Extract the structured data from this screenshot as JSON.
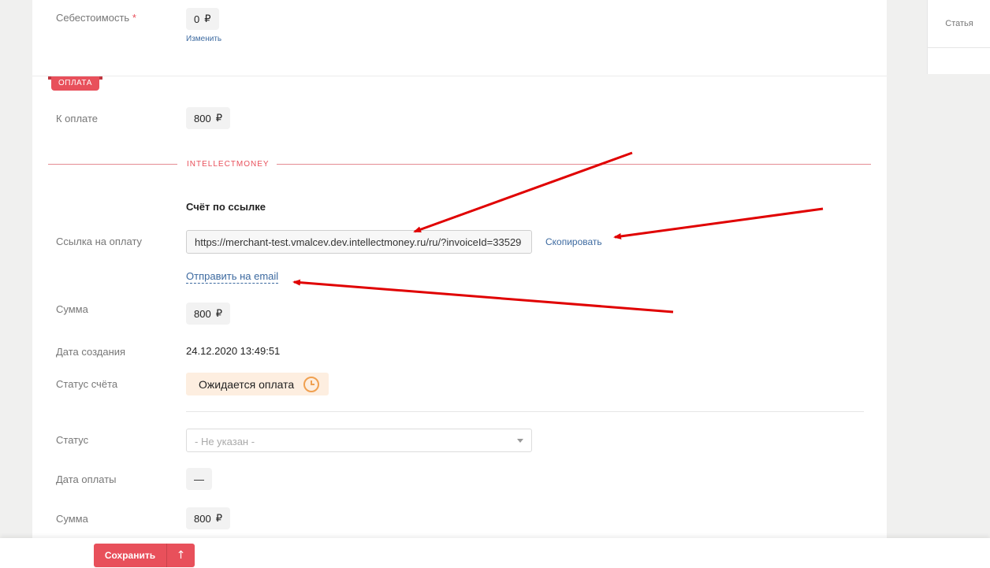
{
  "side": {
    "tab_label": "Статья"
  },
  "cost": {
    "label": "Себестоимость",
    "required_mark": "*",
    "value": "0",
    "currency": "₽",
    "change_link": "Изменить"
  },
  "payment_section": {
    "tag": "ОПЛАТА",
    "to_pay_label": "К оплате",
    "to_pay_value": "800",
    "currency": "₽"
  },
  "intellectmoney": {
    "section_label": "INTELLECTMONEY",
    "header": "Счёт по ссылке",
    "link_label": "Ссылка на оплату",
    "link_value": "https://merchant-test.vmalcev.dev.intellectmoney.ru/ru/?invoiceId=33529",
    "copy_label": "Скопировать",
    "email_label": "Отправить на email",
    "sum_label": "Сумма",
    "sum_value": "800",
    "currency": "₽",
    "created_label": "Дата создания",
    "created_value": "24.12.2020 13:49:51",
    "invoice_status_label": "Статус счёта",
    "invoice_status_value": "Ожидается оплата"
  },
  "payment_status": {
    "status_label": "Статус",
    "status_selected": "- Не указан -",
    "pay_date_label": "Дата оплаты",
    "pay_date_value": "—",
    "sum_label": "Сумма",
    "sum_value": "800",
    "currency": "₽"
  },
  "footer": {
    "save_label": "Сохранить",
    "up_icon": "↑"
  },
  "colors": {
    "accent": "#e8505b",
    "link": "#3d6aa0",
    "arrow": "#e00000"
  }
}
